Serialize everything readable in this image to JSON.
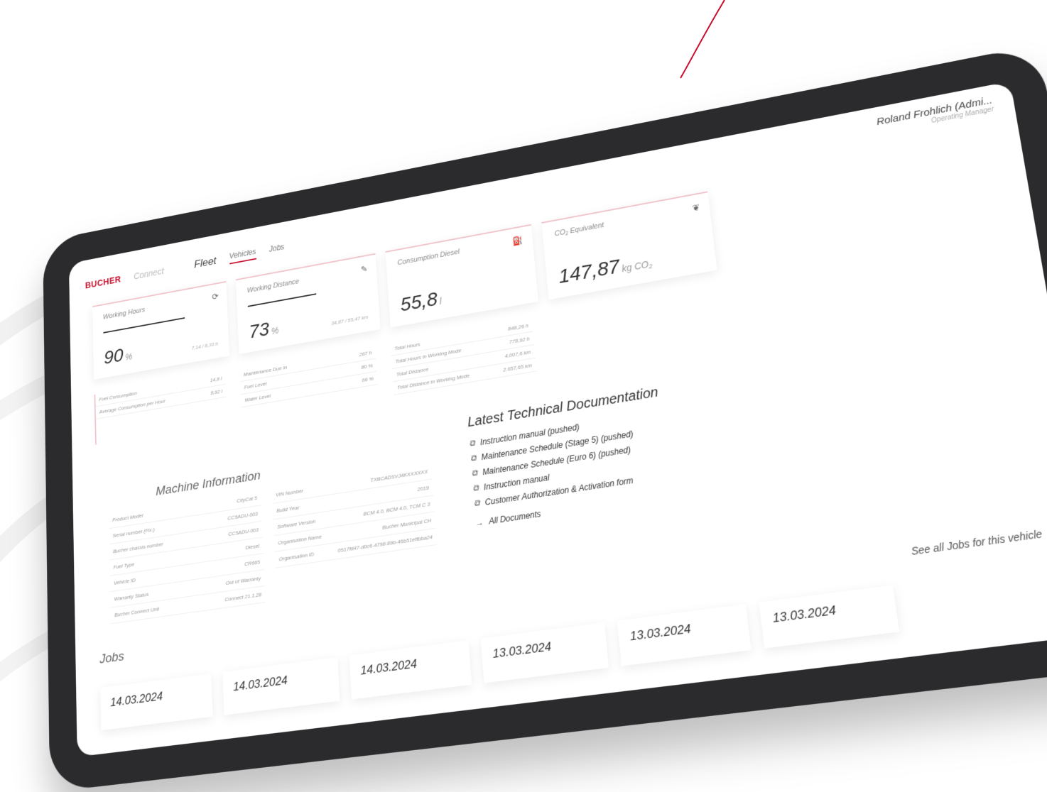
{
  "brand": {
    "logo": "BUCHER",
    "product": "Connect"
  },
  "nav": {
    "fleet": "Fleet",
    "vehicles": "Vehicles",
    "jobs": "Jobs"
  },
  "user": {
    "name": "Roland Frohlich (Admi...",
    "role": "Operating Manager"
  },
  "kpis": [
    {
      "title": "Working Hours",
      "value": "90",
      "unit": "%",
      "note": "7,14 / 8,33 h",
      "progress": 0.9
    },
    {
      "title": "Working Distance",
      "value": "73",
      "unit": "%",
      "note": "34,87 / 55,47 km",
      "progress": 0.73
    },
    {
      "title": "Consumption Diesel",
      "value": "55,8",
      "unit": "l"
    },
    {
      "title": "CO₂ Equivalent",
      "value": "147,87",
      "unit": "kg CO₂"
    }
  ],
  "stats": {
    "col1": [
      {
        "label": "Fuel Consumption",
        "value": "14,8 l"
      },
      {
        "label": "Average Consumption per Hour",
        "value": "8,92 l"
      }
    ],
    "col2": [
      {
        "label": "Maintenance Due in",
        "value": "267 h"
      },
      {
        "label": "Fuel Level",
        "value": "80 %"
      },
      {
        "label": "Water Level",
        "value": "66 %"
      }
    ],
    "col3": [
      {
        "label": "Total Hours",
        "value": "848,26 h"
      },
      {
        "label": "Total Hours in Working Mode",
        "value": "778,92 h"
      },
      {
        "label": "Total Distance",
        "value": "4.007,6 km"
      },
      {
        "label": "Total Distance in Working Mode",
        "value": "2.657,65 km"
      }
    ]
  },
  "machine": {
    "title": "Machine Information",
    "left": [
      {
        "label": "Product Model",
        "value": "CityCat 5"
      },
      {
        "label": "Serial number (Fix.)",
        "value": "CC5ADU-003"
      },
      {
        "label": "Bucher chassis number",
        "value": "CC5ADU-003"
      },
      {
        "label": "Fuel Type",
        "value": "Diesel"
      },
      {
        "label": "Vehicle ID",
        "value": "CR665"
      },
      {
        "label": "Warranty Status",
        "value": "Out of Warranty"
      },
      {
        "label": "Bucher Connect Unit",
        "value": "Connect 21.1.28"
      }
    ],
    "right": [
      {
        "label": "VIN Number",
        "value": "TXBCADSVJ4KXXXXXX"
      },
      {
        "label": "Build Year",
        "value": "2019"
      },
      {
        "label": "Software Version",
        "value": "BCM 4.0, BCM 4.0, TCM C 3"
      },
      {
        "label": "Organisation Name",
        "value": "Bucher Municipal CH"
      },
      {
        "label": "Organisation ID",
        "value": "0517fd47-d0c6-4798-89b-46b51effbba24"
      }
    ]
  },
  "docs": {
    "title": "Latest Technical Documentation",
    "items": [
      "Instruction manual (pushed)",
      "Maintenance Schedule (Stage 5) (pushed)",
      "Maintenance Schedule (Euro 6) (pushed)",
      "Instruction manual",
      "Customer Authorization & Activation form"
    ],
    "all": "All Documents"
  },
  "jobs": {
    "title": "Jobs",
    "link": "See all Jobs for this vehicle",
    "dates": [
      "14.03.2024",
      "14.03.2024",
      "14.03.2024",
      "13.03.2024",
      "13.03.2024",
      "13.03.2024"
    ]
  },
  "colors": {
    "accent": "#c8102e",
    "bezel": "#2b2b2d"
  }
}
